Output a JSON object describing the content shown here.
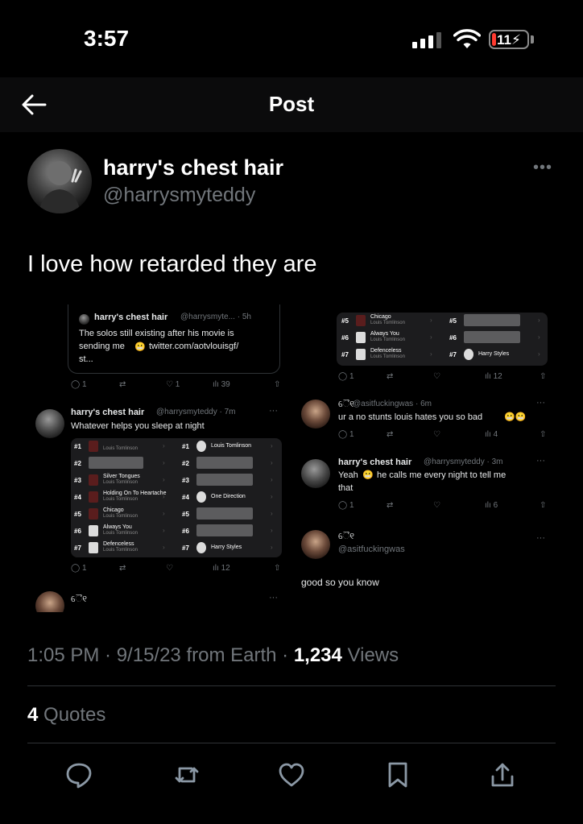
{
  "status_bar": {
    "time": "3:57",
    "battery_percent": "11",
    "battery_level": 0.11,
    "battery_color": "#ff3b30"
  },
  "nav": {
    "title": "Post",
    "back_icon": "arrow-left-icon"
  },
  "post": {
    "display_name": "harry's chest hair",
    "handle": "@harrysmyteddy",
    "text": "I love how retarded they are",
    "timestamp": "1:05 PM · 9/15/23 from Earth · ",
    "views_count": "1,234",
    "views_label": " Views",
    "quotes_count": "4",
    "quotes_label": " Quotes"
  },
  "actions": [
    "reply-icon",
    "retweet-icon",
    "like-icon",
    "bookmark-icon",
    "share-icon"
  ],
  "screenshot": {
    "left": {
      "quoted": {
        "name": "harry's chest hair",
        "handle_time": "@harrysmyte... · 5h",
        "line1": "The solos still existing after his movie is",
        "line2_a": "sending me",
        "line2_b": "twitter.com/aotvlouisgf/",
        "line3": "st..."
      },
      "quoted_stats": {
        "reply": "1",
        "like": "1",
        "views": "39"
      },
      "reply": {
        "name": "harry's chest hair",
        "handle_time": "@harrysmyteddy · 7m",
        "text": "Whatever helps you sleep at night"
      },
      "ranks_left": [
        {
          "num": "#1",
          "song": "",
          "artist": "Louis Tomlinson",
          "thumb": true
        },
        {
          "num": "#2",
          "song": "",
          "artist": "",
          "thumb": false
        },
        {
          "num": "#3",
          "song": "Silver Tongues",
          "artist": "Louis Tomlinson",
          "thumb": true
        },
        {
          "num": "#4",
          "song": "Holding On To Heartache",
          "artist": "Louis Tomlinson",
          "thumb": true
        },
        {
          "num": "#5",
          "song": "Chicago",
          "artist": "Louis Tomlinson",
          "thumb": true
        },
        {
          "num": "#6",
          "song": "Always You",
          "artist": "Louis Tomlinson",
          "thumb": true
        },
        {
          "num": "#7",
          "song": "Defenceless",
          "artist": "Louis Tomlinson",
          "thumb": true
        }
      ],
      "ranks_right": [
        {
          "num": "#1",
          "song": "Louis Tomlinson",
          "blank": false
        },
        {
          "num": "#2",
          "song": "",
          "blank": true
        },
        {
          "num": "#3",
          "song": "",
          "blank": true
        },
        {
          "num": "#4",
          "song": "One Direction",
          "blank": false
        },
        {
          "num": "#5",
          "song": "",
          "blank": true
        },
        {
          "num": "#6",
          "song": "",
          "blank": true
        },
        {
          "num": "#7",
          "song": "Harry Styles",
          "blank": false
        }
      ],
      "reply_stats": {
        "reply": "1",
        "views": "12"
      }
    },
    "right": {
      "ranks_left": [
        {
          "num": "#5",
          "song": "Chicago",
          "artist": "Louis Tomlinson"
        },
        {
          "num": "#6",
          "song": "Always You",
          "artist": "Louis Tomlinson"
        },
        {
          "num": "#7",
          "song": "Defenceless",
          "artist": "Louis Tomlinson"
        }
      ],
      "ranks_right": [
        {
          "num": "#5",
          "song": "",
          "blank": true
        },
        {
          "num": "#6",
          "song": "",
          "blank": true
        },
        {
          "num": "#7",
          "song": "Harry Styles",
          "blank": false
        }
      ],
      "top_stats": {
        "reply": "1",
        "views": "12"
      },
      "reply1": {
        "name": "ୈ୧",
        "handle_time": "@asitfuckingwas · 6m",
        "text": "ur a no stunts louis hates you so bad"
      },
      "reply1_stats": {
        "reply": "1",
        "views": "4"
      },
      "reply2": {
        "name": "harry's chest hair",
        "handle_time": "@harrysmyteddy · 3m",
        "text_a": "Yeah",
        "text_b": "he calls me every night to tell me",
        "text_c": "that"
      },
      "reply2_stats": {
        "reply": "1",
        "views": "6"
      },
      "reply3": {
        "name": "ୈ୧",
        "handle": "@asitfuckingwas",
        "text": "good so you know"
      }
    }
  }
}
